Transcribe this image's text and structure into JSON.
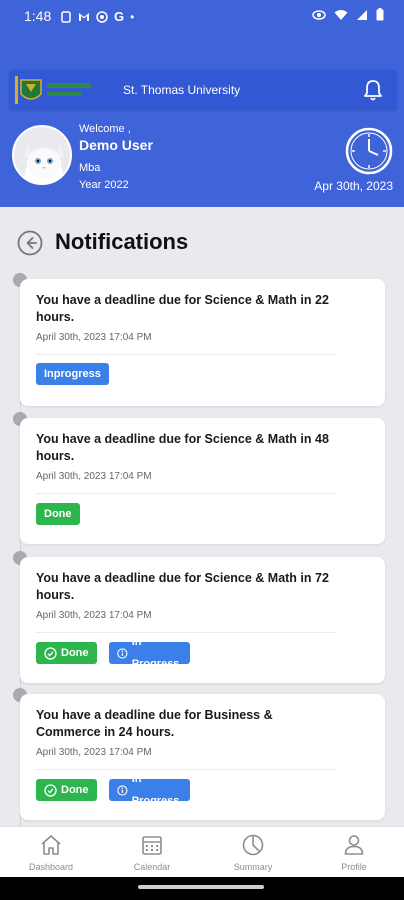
{
  "status_bar": {
    "time": "1:48",
    "dot": "•"
  },
  "header": {
    "university": "St. Thomas University",
    "welcome": "Welcome ,",
    "username": "Demo User",
    "program": "Mba",
    "year": "Year 2022",
    "date": "Apr 30th, 2023"
  },
  "page": {
    "title": "Notifications"
  },
  "notifications": [
    {
      "message": "You have a deadline due for Science & Math in 22 hours.",
      "timestamp": "April 30th, 2023 17:04 PM",
      "badges": [
        "Inprogress"
      ]
    },
    {
      "message": "You have a deadline due for Science & Math in 48 hours.",
      "timestamp": "April 30th, 2023 17:04 PM",
      "badges": [
        "Done"
      ]
    },
    {
      "message": "You have a deadline due for Science & Math in 72 hours.",
      "timestamp": "April 30th, 2023 17:04 PM",
      "badges": [
        "Done",
        "In Progress"
      ]
    },
    {
      "message": "You have a deadline due for Business & Commerce in 24 hours.",
      "timestamp": "April 30th, 2023 17:04 PM",
      "badges": [
        "Done",
        "In Progress"
      ]
    }
  ],
  "bottom_nav": [
    {
      "label": "Dashboard",
      "icon": "home-icon"
    },
    {
      "label": "Calendar",
      "icon": "calendar-icon"
    },
    {
      "label": "Summary",
      "icon": "summary-icon"
    },
    {
      "label": "Profile",
      "icon": "profile-icon"
    }
  ],
  "colors": {
    "header_bg": "#3f63d9",
    "badge_blue": "#3b7fe8",
    "badge_green": "#2eb64e"
  }
}
